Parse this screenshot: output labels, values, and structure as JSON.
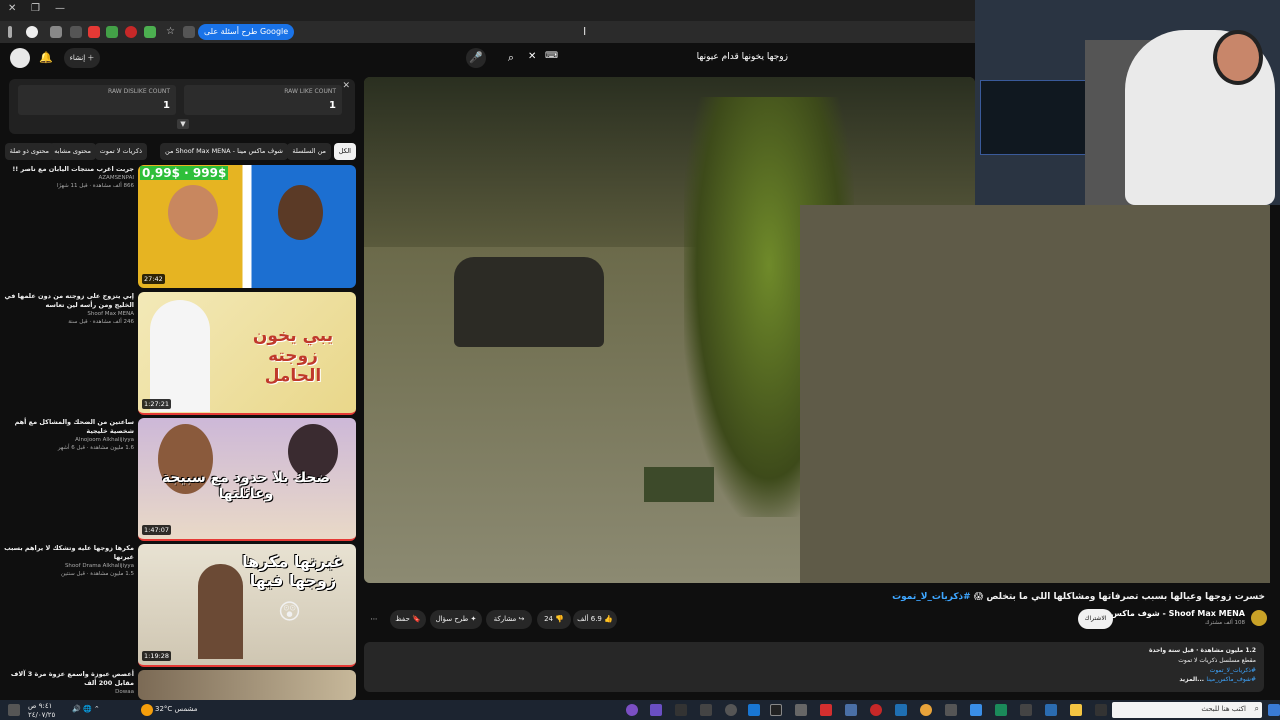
{
  "browser": {
    "lens_chip": "طرح أسئلة على Google",
    "cursor_glyph": "I"
  },
  "header": {
    "search_query": "زوجها يخونها قدام عيونها",
    "create_label": "إنشاء"
  },
  "raw_panel": {
    "like_label": "RAW LIKE COUNT",
    "like_value": "1",
    "dislike_label": "RAW DISLIKE COUNT",
    "dislike_value": "1"
  },
  "chips": [
    "الكل",
    "من السلسلة",
    "من Shoof Max MENA - شوف ماكس مينا",
    "ذكريات لا تموت",
    "محتوى مشابه",
    "محتوى ذو صلة"
  ],
  "recommendations": [
    {
      "title": "جربت اغرب منتجات اليابان مع ناصر !!",
      "channel": "AZAMSENPAI",
      "views": "866 ألف مشاهدة · قبل 11 شهرًا",
      "duration": "27:42",
      "art_text": "999$ · 0,99$"
    },
    {
      "title": "إبي يتزوج على زوجته من دون علمها في الخليج ومن رأسه لين تعاسه",
      "channel": "Shoof Max MENA",
      "views": "246 ألف مشاهدة · قبل سنة",
      "duration": "1:27:21",
      "art_text": "يبي يخون زوجته الحامل"
    },
    {
      "title": "ساعتين من الضحك والمشاكل مع أهم شخصية خليجية",
      "channel": "Alnojoom Alkhalijiyya",
      "views": "1.6 مليون مشاهدة · قبل 6 أشهر",
      "duration": "1:47:07",
      "art_text": "ضحك بلا حدود مع سبيجة وعائلتها"
    },
    {
      "title": "مكرها زوجها عليه وتشكك لا يراهم بسبب غيرتها",
      "channel": "Shoof Drama Alkhalijiyya",
      "views": "1.5 مليون مشاهدة · قبل سنتين",
      "duration": "1:19:28",
      "art_text": "غيرتها مكرها زوجها فيها"
    },
    {
      "title": "أعصص عبوزة واسمع عزوة مرة 3 آلاف مقابل 200 ألف",
      "channel": "Dowaa",
      "views": "",
      "duration": "",
      "art_text": ""
    }
  ],
  "video": {
    "title_text": "خسرت زوجها وعيالها بسبب تصرفاتها ومشاكلها اللي ما بتخلص 😱 ",
    "title_hashtag": "#ذكريات_لا_تموت",
    "channel_name": "Shoof Max MENA - شوف ماكس مينا",
    "subscribers": "108 ألف مشترك",
    "join_label": "الاشتراك",
    "likes": "6.9 ألف",
    "dislikes": "24",
    "share_label": "مشاركة",
    "ask_label": "طرح سؤال",
    "save_label": "حفظ",
    "more_label": "⋯"
  },
  "description": {
    "line1": "1.2 مليون مشاهدة · قبل سنة واحدة",
    "line2": "مقطع مسلسل ذكريات لا تموت",
    "line3": "#ذكريات_لا_تموت",
    "line4": "#شوف_ماكس_مينا",
    "more": "...المزيد"
  },
  "taskbar": {
    "search_placeholder": "اكتب هنا للبحث",
    "weather": "32°C مشمس",
    "time": "٩:٤١ ص",
    "date": "٢٤/٠٧/٢٥"
  }
}
